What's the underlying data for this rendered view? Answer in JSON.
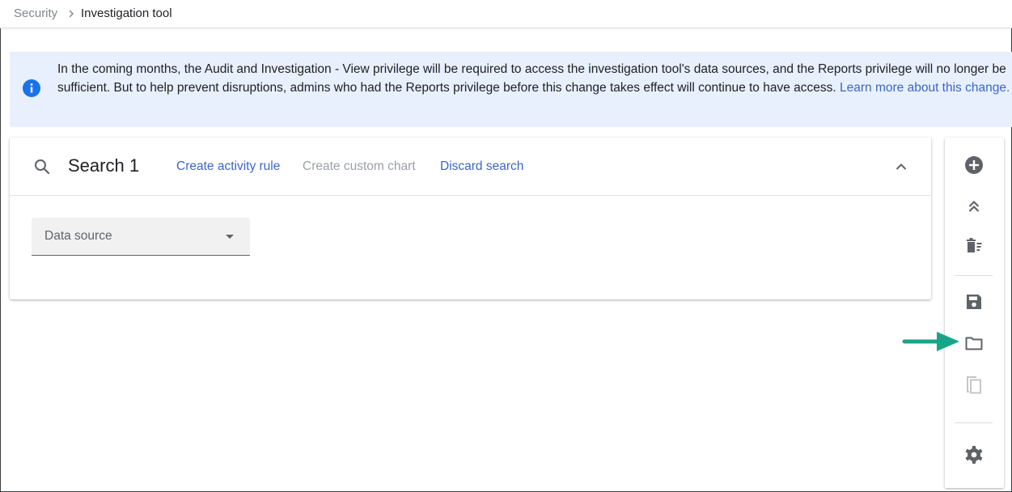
{
  "breadcrumb": {
    "parent": "Security",
    "current": "Investigation tool"
  },
  "banner": {
    "icon": "info-icon",
    "text": "In the coming months, the Audit and Investigation - View privilege will be required to access the investigation tool's data sources, and the Reports privilege will no longer be sufficient. But to help prevent disruptions, admins who had the Reports privilege before this change takes effect will continue to have access. ",
    "link": "Learn more about this change."
  },
  "search": {
    "title": "Search 1",
    "actions": {
      "create_activity_rule": "Create activity rule",
      "create_custom_chart": "Create custom chart",
      "discard_search": "Discard search"
    },
    "data_source": {
      "label": "Data source"
    }
  },
  "toolbar": {
    "buttons": [
      "add-search-icon",
      "collapse-all-icon",
      "delete-all-icon",
      "save-icon",
      "open-folder-icon",
      "copy-icon",
      "settings-icon"
    ]
  },
  "colors": {
    "banner_bg": "#e8f0fe",
    "link": "#3c66c4",
    "disabled": "#9aa0a6",
    "info_icon": "#1a73e8",
    "arrow": "#17a589"
  }
}
